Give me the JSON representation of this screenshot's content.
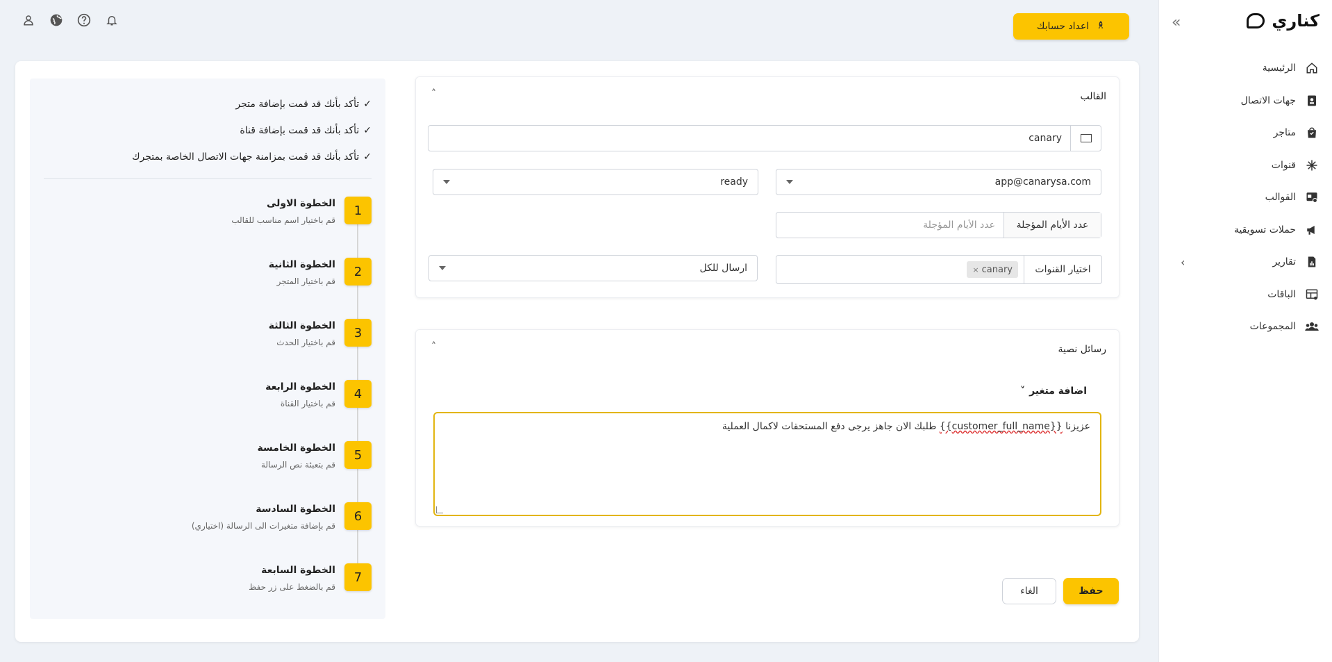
{
  "brand": {
    "name": "كناري"
  },
  "sidebar": {
    "items": [
      {
        "label": "الرئيسية",
        "icon": "home-icon"
      },
      {
        "label": "جهات الاتصال",
        "icon": "contacts-icon"
      },
      {
        "label": "متاجر",
        "icon": "store-bag-icon"
      },
      {
        "label": "قنوات",
        "icon": "channels-asterisk-icon"
      },
      {
        "label": "القوالب",
        "icon": "templates-icon"
      },
      {
        "label": "حملات تسويقية",
        "icon": "megaphone-icon"
      },
      {
        "label": "تقارير",
        "icon": "reports-icon"
      },
      {
        "label": "الباقات",
        "icon": "packages-icon"
      },
      {
        "label": "المجموعات",
        "icon": "groups-icon"
      }
    ]
  },
  "topbar": {
    "setup_label": "اعداد حسابك"
  },
  "checklist": [
    "تأكد بأنك قد قمت بإضافة متجر",
    "تأكد بأنك قد قمت بإضافة قناة",
    "تأكد بأنك قد قمت بمزامنة جهات الاتصال الخاصة بمتجرك"
  ],
  "steps": [
    {
      "num": "1",
      "title": "الخطوة الاولى",
      "desc": "قم باختيار اسم مناسب للقالب"
    },
    {
      "num": "2",
      "title": "الخطوة الثانية",
      "desc": "قم باختيار المتجر"
    },
    {
      "num": "3",
      "title": "الخطوة الثالثة",
      "desc": "قم باختيار الحدث"
    },
    {
      "num": "4",
      "title": "الخطوة الرابعة",
      "desc": "قم باختيار القناة"
    },
    {
      "num": "5",
      "title": "الخطوة الخامسة",
      "desc": "قم بتعبئة نص الرسالة"
    },
    {
      "num": "6",
      "title": "الخطوة السادسة",
      "desc": "قم بإضافة متغيرات الى الرسالة (اختياري)"
    },
    {
      "num": "7",
      "title": "الخطوة السابعة",
      "desc": "قم بالضغط على زر حفظ"
    }
  ],
  "template_panel": {
    "title": "القالب",
    "name_value": "canary",
    "store_value": "app@canarysa.com",
    "event_value": "ready",
    "days_label": "عدد الأيام المؤجلة",
    "days_placeholder": "عدد الأيام المؤجلة",
    "channels_label": "اختيار القنوات",
    "channel_chip": "canary",
    "send_value": "ارسال للكل"
  },
  "sms_panel": {
    "title": "رسائل نصية",
    "add_variable": "اضافة متغير",
    "msg_prefix": "عزيزنا ",
    "msg_variable": "{{customer_full_name}}",
    "msg_suffix": " طلبك الان جاهز يرجى دفع المستحقات لاكمال العملية"
  },
  "actions": {
    "save": "حفظ",
    "cancel": "الغاء"
  },
  "colors": {
    "accent": "#fcc400",
    "background": "#eef2f7"
  }
}
